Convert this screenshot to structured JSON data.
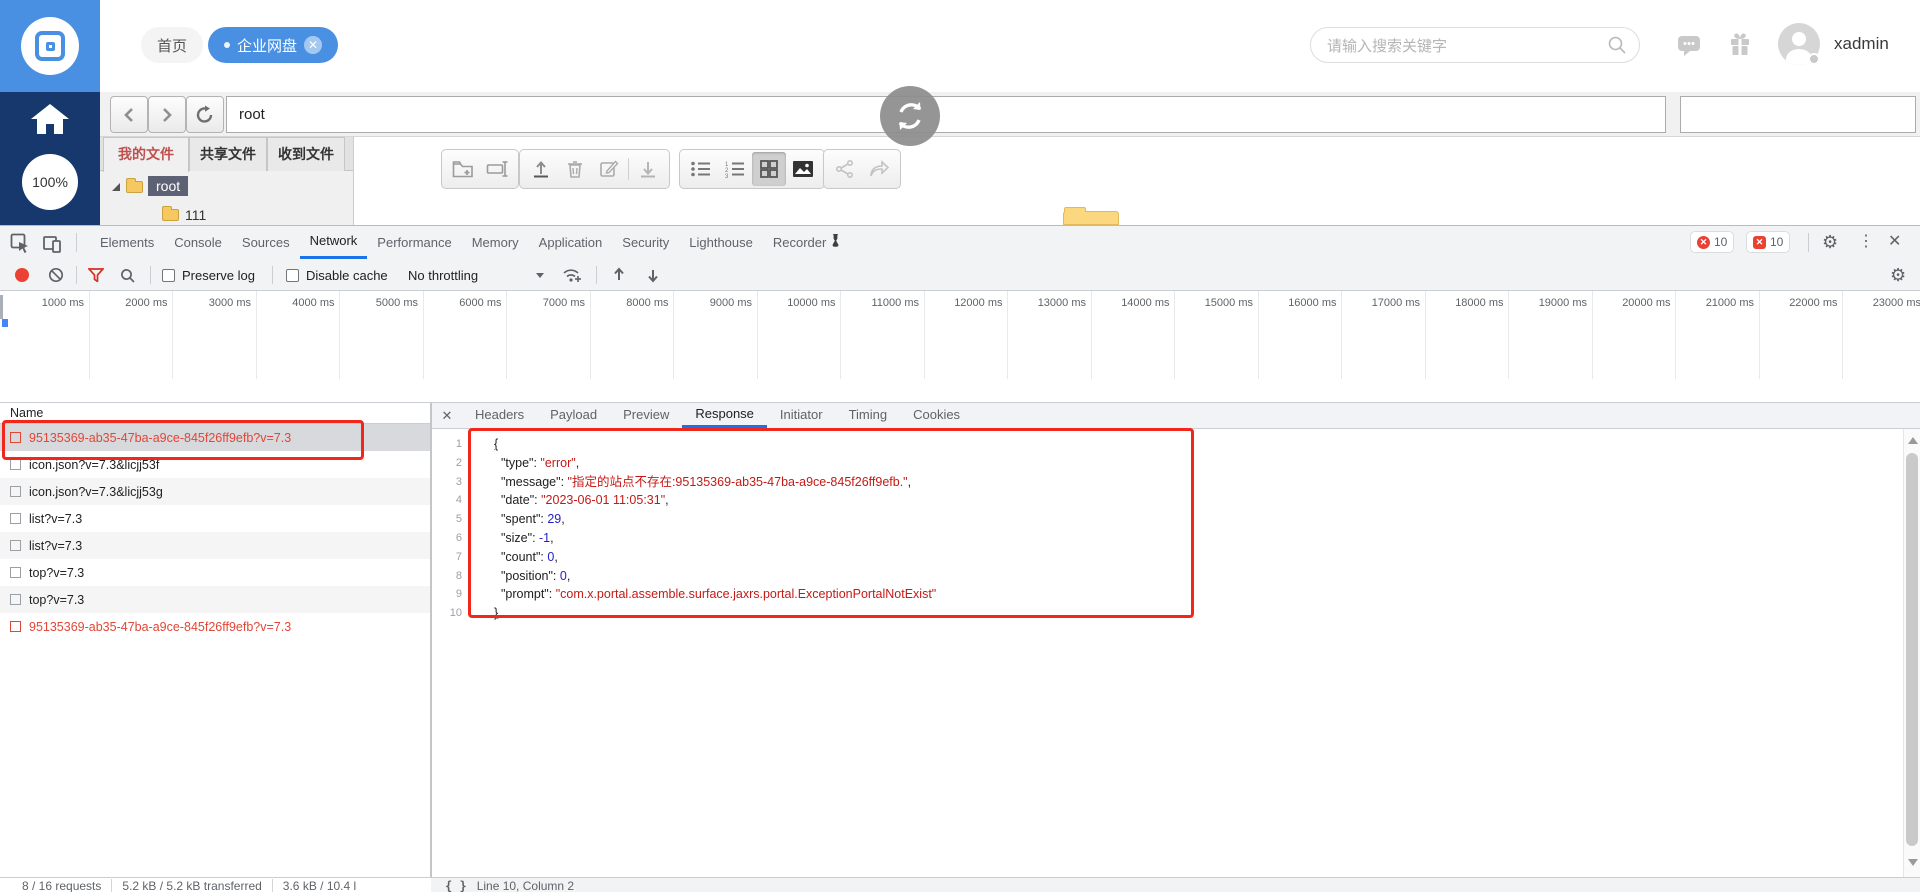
{
  "colors": {
    "brand_blue": "#4a90e2",
    "sidebar_navy": "#16386c",
    "accent_blue": "#1a73e8",
    "error_red": "#e24636",
    "annotation_red": "#f2271c",
    "string_red": "#c41a16",
    "number_blue": "#2222cc"
  },
  "header": {
    "tabs": [
      {
        "label": "首页",
        "active": false
      },
      {
        "label": "企业网盘",
        "active": true
      }
    ],
    "search_placeholder": "请输入搜索关键字",
    "username": "xadmin"
  },
  "sidebar": {
    "zoom_level": "100%"
  },
  "browser_nav": {
    "address_value": "root"
  },
  "file_panel": {
    "tabs": [
      {
        "label": "我的文件",
        "active": true
      },
      {
        "label": "共享文件",
        "active": false
      },
      {
        "label": "收到文件",
        "active": false
      }
    ],
    "tree": [
      {
        "label": "root",
        "selected": true
      },
      {
        "label": "111",
        "selected": false
      }
    ]
  },
  "devtools": {
    "tabs": [
      "Elements",
      "Console",
      "Sources",
      "Network",
      "Performance",
      "Memory",
      "Application",
      "Security",
      "Lighthouse",
      "Recorder"
    ],
    "active_tab": "Network",
    "error_count": "10",
    "issue_count": "10",
    "network_toolbar": {
      "preserve_log": "Preserve log",
      "disable_cache": "Disable cache",
      "throttling": "No throttling"
    },
    "timeline_ticks": [
      "1000 ms",
      "2000 ms",
      "3000 ms",
      "4000 ms",
      "5000 ms",
      "6000 ms",
      "7000 ms",
      "8000 ms",
      "9000 ms",
      "10000 ms",
      "11000 ms",
      "12000 ms",
      "13000 ms",
      "14000 ms",
      "15000 ms",
      "16000 ms",
      "17000 ms",
      "18000 ms",
      "19000 ms",
      "20000 ms",
      "21000 ms",
      "22000 ms",
      "23000 ms"
    ],
    "requests": {
      "name_header": "Name",
      "rows": [
        {
          "name": "95135369-ab35-47ba-a9ce-845f26ff9efb?v=7.3",
          "error": true,
          "selected": true
        },
        {
          "name": "icon.json?v=7.3&licjj53f",
          "error": false,
          "selected": false
        },
        {
          "name": "icon.json?v=7.3&licjj53g",
          "error": false,
          "selected": false
        },
        {
          "name": "list?v=7.3",
          "error": false,
          "selected": false
        },
        {
          "name": "list?v=7.3",
          "error": false,
          "selected": false
        },
        {
          "name": "top?v=7.3",
          "error": false,
          "selected": false
        },
        {
          "name": "top?v=7.3",
          "error": false,
          "selected": false
        },
        {
          "name": "95135369-ab35-47ba-a9ce-845f26ff9efb?v=7.3",
          "error": true,
          "selected": false
        }
      ]
    },
    "response_tabs": [
      "Headers",
      "Payload",
      "Preview",
      "Response",
      "Initiator",
      "Timing",
      "Cookies"
    ],
    "active_response_tab": "Response",
    "json_lines": [
      {
        "num": "1",
        "segs": [
          [
            "brace",
            "{"
          ]
        ]
      },
      {
        "num": "2",
        "segs": [
          [
            "pun",
            "  "
          ],
          [
            "key",
            "\"type\""
          ],
          [
            "pun",
            ": "
          ],
          [
            "str",
            "\"error\""
          ],
          [
            "pun",
            ","
          ]
        ]
      },
      {
        "num": "3",
        "segs": [
          [
            "pun",
            "  "
          ],
          [
            "key",
            "\"message\""
          ],
          [
            "pun",
            ": "
          ],
          [
            "str",
            "\"指定的站点不存在:95135369-ab35-47ba-a9ce-845f26ff9efb.\""
          ],
          [
            "pun",
            ","
          ]
        ]
      },
      {
        "num": "4",
        "segs": [
          [
            "pun",
            "  "
          ],
          [
            "key",
            "\"date\""
          ],
          [
            "pun",
            ": "
          ],
          [
            "str",
            "\"2023-06-01 11:05:31\""
          ],
          [
            "pun",
            ","
          ]
        ]
      },
      {
        "num": "5",
        "segs": [
          [
            "pun",
            "  "
          ],
          [
            "key",
            "\"spent\""
          ],
          [
            "pun",
            ": "
          ],
          [
            "num",
            "29"
          ],
          [
            "pun",
            ","
          ]
        ]
      },
      {
        "num": "6",
        "segs": [
          [
            "pun",
            "  "
          ],
          [
            "key",
            "\"size\""
          ],
          [
            "pun",
            ": "
          ],
          [
            "num",
            "-1"
          ],
          [
            "pun",
            ","
          ]
        ]
      },
      {
        "num": "7",
        "segs": [
          [
            "pun",
            "  "
          ],
          [
            "key",
            "\"count\""
          ],
          [
            "pun",
            ": "
          ],
          [
            "num",
            "0"
          ],
          [
            "pun",
            ","
          ]
        ]
      },
      {
        "num": "8",
        "segs": [
          [
            "pun",
            "  "
          ],
          [
            "key",
            "\"position\""
          ],
          [
            "pun",
            ": "
          ],
          [
            "num",
            "0"
          ],
          [
            "pun",
            ","
          ]
        ]
      },
      {
        "num": "9",
        "segs": [
          [
            "pun",
            "  "
          ],
          [
            "key",
            "\"prompt\""
          ],
          [
            "pun",
            ": "
          ],
          [
            "str",
            "\"com.x.portal.assemble.surface.jaxrs.portal.ExceptionPortalNotExist\""
          ]
        ]
      },
      {
        "num": "10",
        "segs": [
          [
            "brace",
            "}"
          ]
        ]
      }
    ],
    "status_left": [
      "8 / 16 requests",
      "5.2 kB / 5.2 kB transferred",
      "3.6 kB / 10.4 l"
    ],
    "status_right": "Line 10, Column 2"
  }
}
